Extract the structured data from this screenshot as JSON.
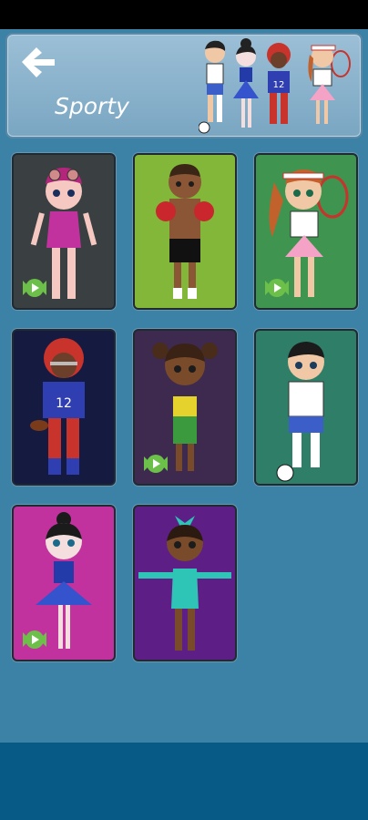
{
  "header": {
    "title": "Sporty",
    "back_icon": "arrow-left-icon"
  },
  "colors": {
    "background": "#3b82a6",
    "bottom_bar": "#075a86",
    "ad_badge": "#6cc04a"
  },
  "outfits": [
    {
      "id": "swimmer",
      "bg": "#3a4042",
      "locked_ad": true
    },
    {
      "id": "boxer",
      "bg": "#82b73a",
      "locked_ad": false
    },
    {
      "id": "tennis",
      "bg": "#3f9450",
      "locked_ad": true
    },
    {
      "id": "football",
      "bg": "#141a40",
      "locked_ad": false,
      "jersey_number": "12"
    },
    {
      "id": "runner",
      "bg": "#3d2a4e",
      "locked_ad": true
    },
    {
      "id": "soccer",
      "bg": "#2f7f68",
      "locked_ad": false
    },
    {
      "id": "ballerina",
      "bg": "#c2329e",
      "locked_ad": true
    },
    {
      "id": "gymnast",
      "bg": "#5d1f86",
      "locked_ad": false
    }
  ]
}
